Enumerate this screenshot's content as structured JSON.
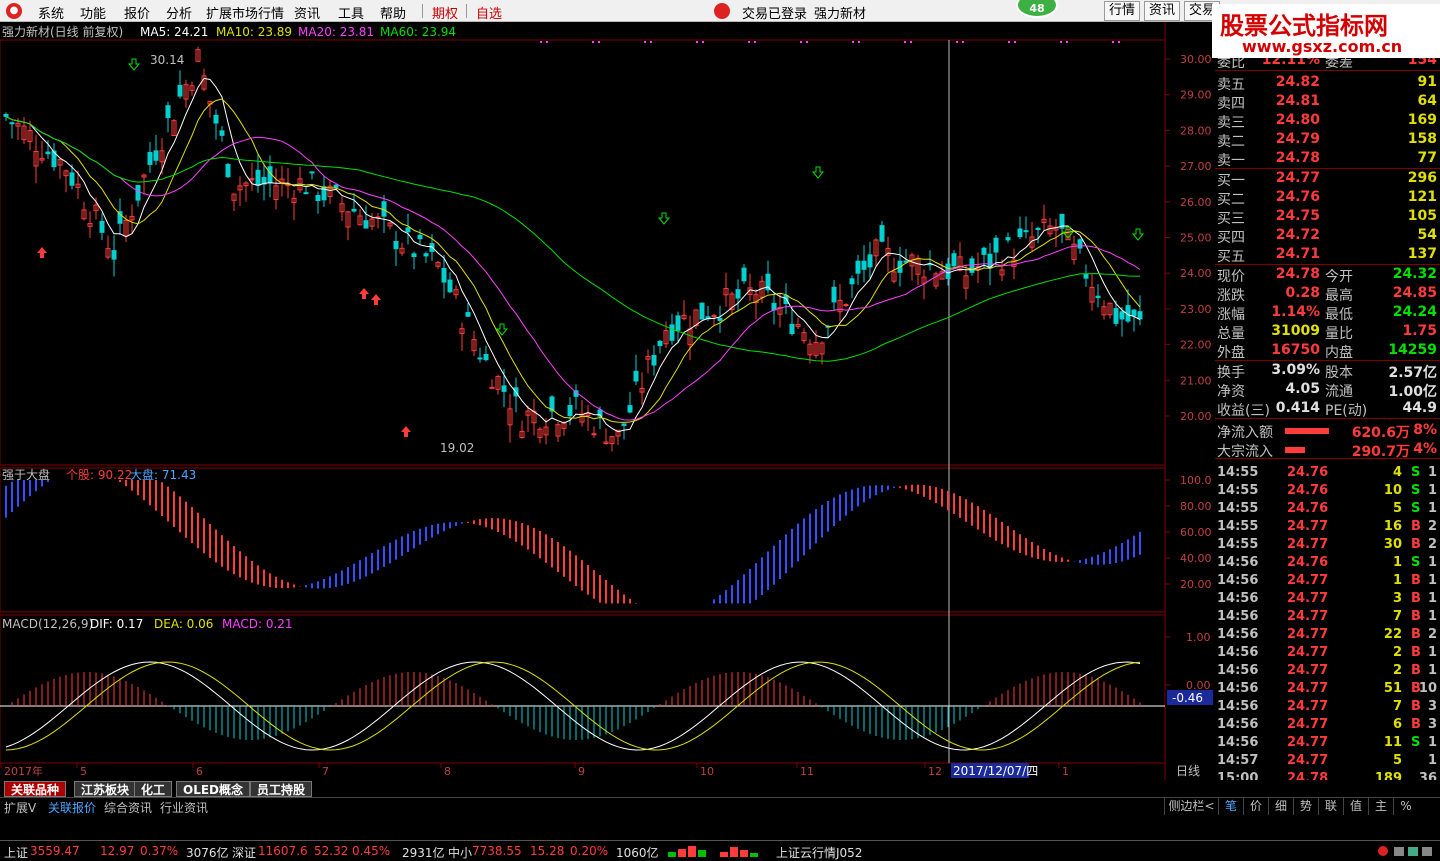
{
  "menu": {
    "items": [
      "系统",
      "功能",
      "报价",
      "分析",
      "扩展市场行情",
      "资讯",
      "工具",
      "帮助",
      "期权",
      "自选"
    ],
    "status": "交易已登录",
    "stock_name": "强力新材",
    "badge": "48",
    "buttons": [
      "行情",
      "资讯",
      "交易"
    ]
  },
  "watermark": {
    "title": "股票公式指标网",
    "url": "www.gsxz.com.cn"
  },
  "main_legend": {
    "title": "强力新材(日线 前复权)",
    "ma5": "MA5: 24.21",
    "ma10": "MA10: 23.89",
    "ma20": "MA20: 23.81",
    "ma60": "MA60: 23.94",
    "high_label": "30.14",
    "low_label": "19.02"
  },
  "indicator1": {
    "name": "强于大盘",
    "stock": "个股: 90.22",
    "market": "大盘: 71.43"
  },
  "indicator2": {
    "name": "MACD(12,26,9)",
    "dif": "DIF: 0.17",
    "dea": "DEA: 0.06",
    "macd": "MACD: 0.21",
    "marker": "-0.46"
  },
  "axis": {
    "price_ticks": [
      "30.00",
      "29.00",
      "28.00",
      "27.00",
      "26.00",
      "25.00",
      "24.00",
      "23.00",
      "22.00",
      "21.00",
      "20.00"
    ],
    "ind1_ticks": [
      "100.0",
      "80.00",
      "60.00",
      "40.00",
      "20.00"
    ],
    "ind2_ticks": [
      "1.00",
      "0.00"
    ],
    "months": [
      "2017年",
      "5",
      "6",
      "7",
      "8",
      "9",
      "10",
      "11",
      "12",
      "1"
    ],
    "crosshair_date": "2017/12/07/四",
    "period": "日线"
  },
  "quote": {
    "top_cut": [
      "委比",
      "12.11%",
      "委差",
      "154"
    ],
    "asks": [
      [
        "卖五",
        "24.82",
        "91"
      ],
      [
        "卖四",
        "24.81",
        "64"
      ],
      [
        "卖三",
        "24.80",
        "169"
      ],
      [
        "卖二",
        "24.79",
        "158"
      ],
      [
        "卖一",
        "24.78",
        "77"
      ]
    ],
    "bids": [
      [
        "买一",
        "24.77",
        "296"
      ],
      [
        "买二",
        "24.76",
        "121"
      ],
      [
        "买三",
        "24.75",
        "105"
      ],
      [
        "买四",
        "24.72",
        "54"
      ],
      [
        "买五",
        "24.71",
        "137"
      ]
    ],
    "stats": [
      [
        "现价",
        "24.78",
        "今开",
        "24.32"
      ],
      [
        "涨跌",
        "0.28",
        "最高",
        "24.85"
      ],
      [
        "涨幅",
        "1.14%",
        "最低",
        "24.24"
      ],
      [
        "总量",
        "31009",
        "量比",
        "1.75"
      ],
      [
        "外盘",
        "16750",
        "内盘",
        "14259"
      ]
    ],
    "extra": [
      [
        "换手",
        "3.09%",
        "股本",
        "2.57亿"
      ],
      [
        "净资",
        "4.05",
        "流通",
        "1.00亿"
      ],
      [
        "收益(三)",
        "0.414",
        "PE(动)",
        "44.9"
      ]
    ],
    "flows": [
      [
        "净流入额",
        "620.6万",
        "8%"
      ],
      [
        "大宗流入",
        "290.7万",
        "4%"
      ]
    ]
  },
  "ticks": [
    [
      "14:55",
      "24.76",
      "4",
      "S",
      "1"
    ],
    [
      "14:55",
      "24.76",
      "10",
      "S",
      "1"
    ],
    [
      "14:55",
      "24.76",
      "5",
      "S",
      "1"
    ],
    [
      "14:55",
      "24.77",
      "16",
      "B",
      "2"
    ],
    [
      "14:55",
      "24.77",
      "30",
      "B",
      "2"
    ],
    [
      "14:56",
      "24.76",
      "1",
      "S",
      "1"
    ],
    [
      "14:56",
      "24.77",
      "1",
      "B",
      "1"
    ],
    [
      "14:56",
      "24.77",
      "3",
      "B",
      "1"
    ],
    [
      "14:56",
      "24.77",
      "7",
      "B",
      "1"
    ],
    [
      "14:56",
      "24.77",
      "22",
      "B",
      "2"
    ],
    [
      "14:56",
      "24.77",
      "2",
      "B",
      "1"
    ],
    [
      "14:56",
      "24.77",
      "2",
      "B",
      "1"
    ],
    [
      "14:56",
      "24.77",
      "51",
      "B",
      "10"
    ],
    [
      "14:56",
      "24.77",
      "7",
      "B",
      "3"
    ],
    [
      "14:56",
      "24.77",
      "6",
      "B",
      "3"
    ],
    [
      "14:56",
      "24.77",
      "11",
      "S",
      "1"
    ],
    [
      "14:57",
      "24.77",
      "5",
      "",
      "1"
    ],
    [
      "15:00",
      "24.78",
      "189",
      "",
      "36"
    ]
  ],
  "tabs_row1": [
    "关联品种",
    "江苏板块",
    "化工",
    "OLED概念",
    "员工持股"
  ],
  "tabs_row2": [
    "扩展V",
    "关联报价",
    "综合资讯",
    "行业资讯"
  ],
  "right_tabs": [
    "侧边栏<",
    "笔",
    "价",
    "细",
    "势",
    "联",
    "值",
    "主",
    "%"
  ],
  "status_bar": {
    "sh": [
      "上证",
      "3559.47",
      "12.97",
      "0.37%",
      "3076亿"
    ],
    "sz": [
      "深证",
      "11607.6",
      "52.32",
      "0.45%",
      "2931亿"
    ],
    "zx": [
      "中小",
      "7738.55",
      "15.28",
      "0.20%",
      "1060亿"
    ],
    "cloud": "上证云行情J052"
  },
  "colors": {
    "up": "#ff3b3b",
    "down": "#00d0d0",
    "ma5": "#ffffff",
    "ma10": "#e0e000",
    "ma20": "#ff40ff",
    "ma60": "#00e000",
    "grid": "#800000"
  }
}
